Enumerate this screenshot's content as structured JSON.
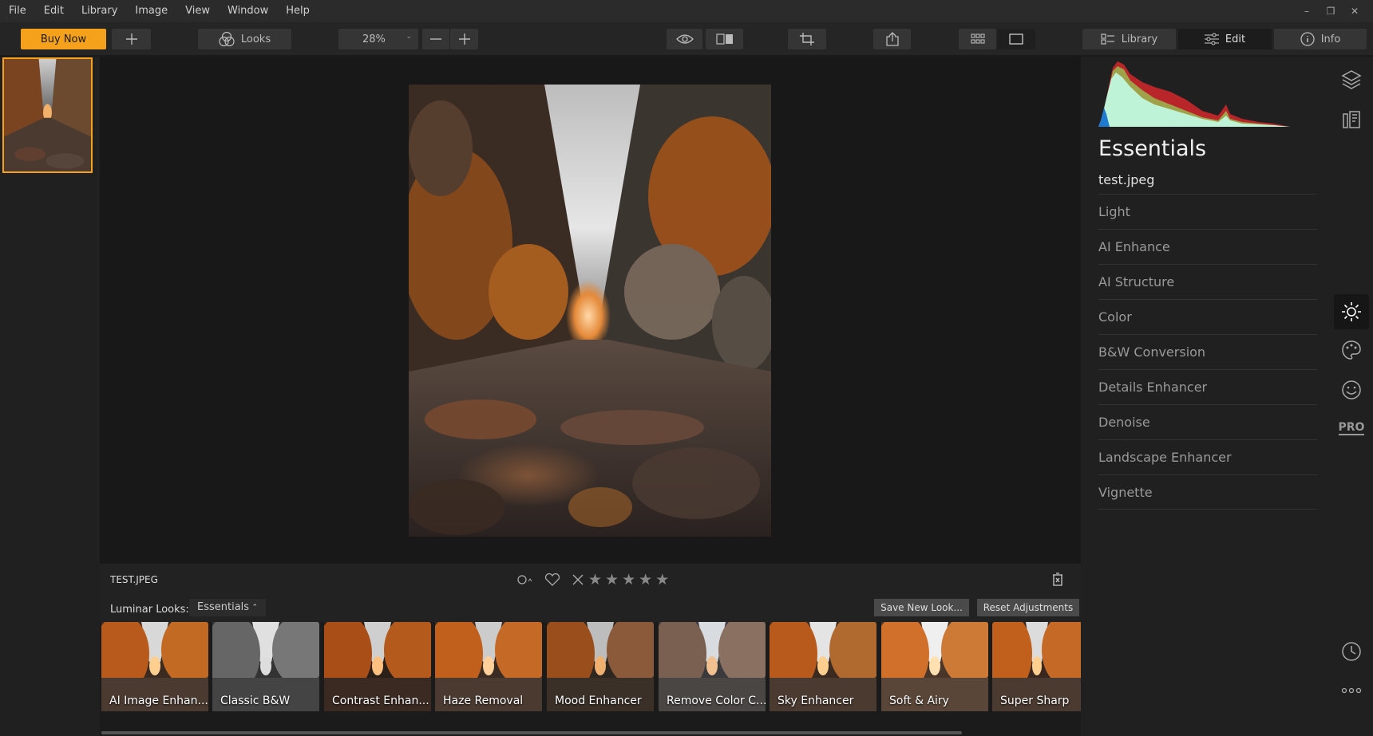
{
  "menu": [
    "File",
    "Edit",
    "Library",
    "Image",
    "View",
    "Window",
    "Help"
  ],
  "window_controls": [
    "–",
    "❐",
    "✕"
  ],
  "toolbar": {
    "buy_now": "Buy Now",
    "looks": "Looks",
    "zoom": "28%",
    "tabs": {
      "library": "Library",
      "edit": "Edit",
      "info": "Info"
    }
  },
  "image": {
    "filename": "TEST.JPEG"
  },
  "looks_bar": {
    "label": "Luminar Looks:",
    "collection": "Essentials",
    "save": "Save New Look...",
    "reset": "Reset Adjustments",
    "items": [
      {
        "label": "AI Image Enhan..."
      },
      {
        "label": "Classic B&W"
      },
      {
        "label": "Contrast Enhan..."
      },
      {
        "label": "Haze Removal"
      },
      {
        "label": "Mood Enhancer"
      },
      {
        "label": "Remove Color C..."
      },
      {
        "label": "Sky Enhancer"
      },
      {
        "label": "Soft & Airy"
      },
      {
        "label": "Super Sharp"
      }
    ]
  },
  "panel": {
    "title": "Essentials",
    "file": "test.jpeg",
    "tools": [
      "Light",
      "AI Enhance",
      "AI Structure",
      "Color",
      "B&W Conversion",
      "Details Enhancer",
      "Denoise",
      "Landscape Enhancer",
      "Vignette"
    ]
  },
  "rail": {
    "pro": "PRO"
  },
  "colors": {
    "accent": "#f5a11c",
    "panel_bg": "#202020",
    "canvas_bg": "#181818"
  }
}
